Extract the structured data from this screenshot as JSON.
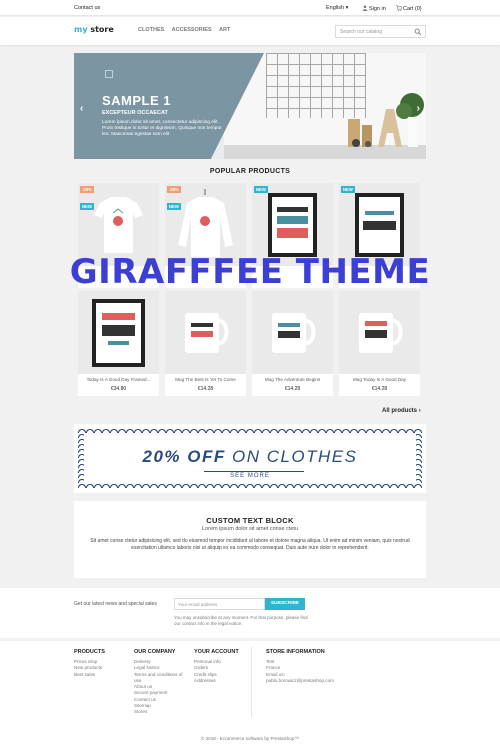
{
  "topbar": {
    "contact": "Contact us",
    "language": "English",
    "sign_in": "Sign in",
    "cart": "Cart (0)"
  },
  "header": {
    "logo_part1": "my",
    "logo_part2": " store",
    "menu": [
      "Clothes",
      "Accessories",
      "Art"
    ],
    "search_placeholder": "Search our catalog"
  },
  "slider": {
    "title": "SAMPLE 1",
    "subtitle": "EXCEPTEUR OCCAECAT",
    "text": "Lorem ipsum dolor sit amet, consectetur adipiscing elit. Proin tristique in tortor et dignissim. Quisque non tempor leo. Maecenas egestas sem elit"
  },
  "popular_title": "POPULAR PRODUCTS",
  "products": [
    {
      "badge_discount": "-20%",
      "badge_new": "NEW",
      "name": "",
      "price": ""
    },
    {
      "badge_discount": "-20%",
      "badge_new": "NEW",
      "name": "",
      "price": ""
    },
    {
      "badge_discount": "",
      "badge_new": "NEW",
      "name": "",
      "price": ""
    },
    {
      "badge_discount": "",
      "badge_new": "NEW",
      "name": "",
      "price": ""
    },
    {
      "badge_discount": "",
      "badge_new": "",
      "name": "Today Is A Good Day Framed...",
      "price": "€34.80"
    },
    {
      "badge_discount": "",
      "badge_new": "",
      "name": "Mug The Best Is Yet To Come",
      "price": "€14.28"
    },
    {
      "badge_discount": "",
      "badge_new": "",
      "name": "Mug The Adventure Begins",
      "price": "€14.28"
    },
    {
      "badge_discount": "",
      "badge_new": "",
      "name": "Mug Today Is A Good Day",
      "price": "€14.28"
    }
  ],
  "watermark": "GIRAFFFEE THEME",
  "all_products": "All products",
  "promo": {
    "headline_bold": "20% OFF",
    "headline_rest": " ON CLOTHES",
    "cta": "SEE MORE"
  },
  "custom": {
    "title": "CUSTOM TEXT BLOCK",
    "subtitle": "Lorem ipsum dolor sit amet conse ctetu",
    "text": "Sit amet conse ctetur adipisicing elit, sed do eiusmod tempor incididunt ut labore et dolore magna aliqua. Ut enim ad minim veniam, quis nostrud exercitation ullamco laboris nisi ut aliquip ex ea commodo consequat. Duis aute irure dolor in reprehenderit."
  },
  "newsletter": {
    "label": "Get our latest news and special sales",
    "placeholder": "Your email address",
    "button": "SUBSCRIBE",
    "note": "You may unsubscribe at any moment. For that purpose, please find our contact info in the legal notice."
  },
  "footer": {
    "products": {
      "title": "PRODUCTS",
      "links": [
        "Prices drop",
        "New products",
        "Best sales"
      ]
    },
    "company": {
      "title": "OUR COMPANY",
      "links": [
        "Delivery",
        "Legal Notice",
        "Terms and conditions of",
        "use",
        "About us",
        "Secure payment",
        "Contact us",
        "Sitemap",
        "Stores"
      ]
    },
    "account": {
      "title": "YOUR ACCOUNT",
      "links": [
        "Personal info",
        "Orders",
        "Credit slips",
        "Addresses"
      ]
    },
    "store": {
      "title": "STORE INFORMATION",
      "lines": [
        "Test",
        "France",
        "Email us:",
        "pablo.borowicz@prestashop.com"
      ]
    },
    "copyright": "© 2018 - Ecommerce software by PrestaShop™"
  },
  "colors": {
    "accent": "#2fb5d2",
    "discount": "#f39d72",
    "promo_blue": "#2a4c7d",
    "watermark": "#3c3fd4"
  }
}
